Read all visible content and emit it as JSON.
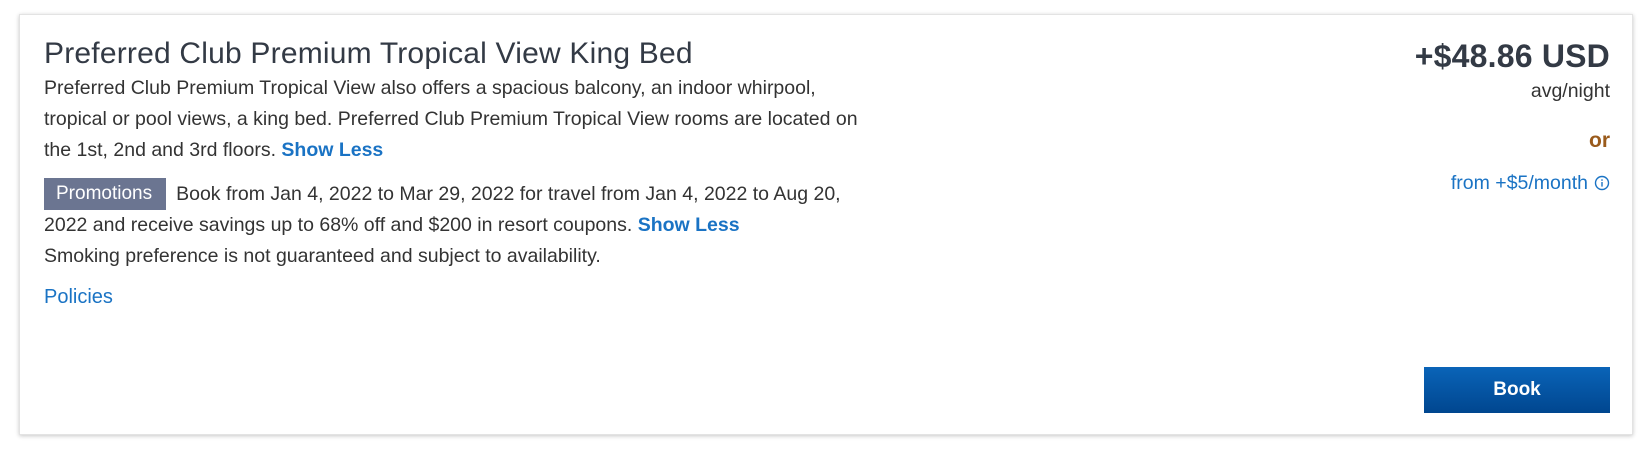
{
  "room": {
    "title": "Preferred Club Premium Tropical View King Bed",
    "description": "Preferred Club Premium Tropical View also offers a spacious balcony, an indoor whirpool, tropical or pool views, a king bed. Preferred Club Premium Tropical View rooms are located on the 1st, 2nd and 3rd floors. ",
    "description_toggle": "Show Less",
    "promo_badge": "Promotions",
    "promo_text": "Book from Jan 4, 2022 to Mar 29, 2022 for travel from Jan 4, 2022 to Aug 20, 2022 and receive savings up to 68% off and $200 in resort coupons. ",
    "promo_toggle": "Show Less",
    "smoking_note": "Smoking preference is not guaranteed and subject to availability.",
    "policies_link": "Policies"
  },
  "pricing": {
    "price": "+$48.86 USD",
    "per": "avg/night",
    "or": "or",
    "monthly": "from +$5/month",
    "info_icon": "info-circle-icon"
  },
  "actions": {
    "book_label": "Book"
  },
  "colors": {
    "link": "#1a73c4",
    "badge": "#6b7591",
    "or_accent": "#9a5b1c",
    "book_button": "#0a5cad"
  }
}
